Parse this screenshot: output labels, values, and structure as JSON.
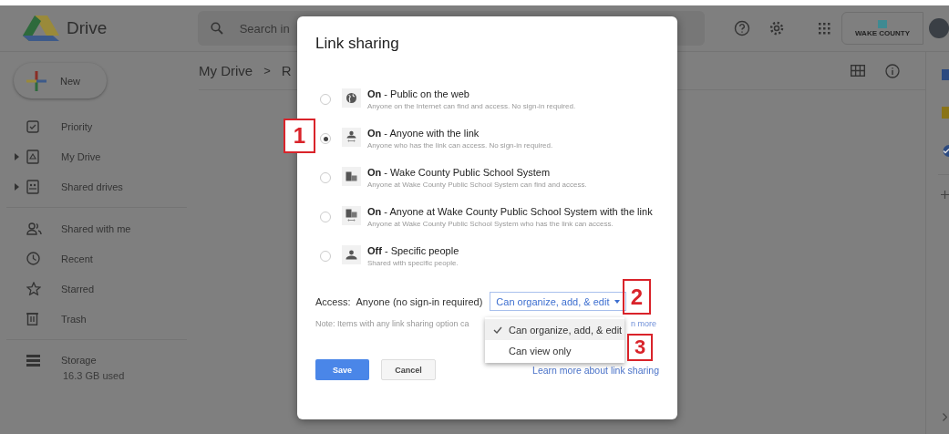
{
  "header": {
    "app_name": "Drive",
    "search": {
      "placeholder": "Search in"
    },
    "org_logo": "WAKE COUNTY"
  },
  "sidebar": {
    "new_button": "New",
    "groups": [
      [
        {
          "label": "Priority",
          "expandable": false
        },
        {
          "label": "My Drive",
          "expandable": true
        },
        {
          "label": "Shared drives",
          "expandable": true
        }
      ],
      [
        {
          "label": "Shared with me",
          "expandable": false
        },
        {
          "label": "Recent",
          "expandable": false
        },
        {
          "label": "Starred",
          "expandable": false
        },
        {
          "label": "Trash",
          "expandable": false
        }
      ],
      [
        {
          "label": "Storage",
          "expandable": false,
          "detail": "16.3 GB used"
        }
      ]
    ]
  },
  "breadcrumb": [
    "My Drive",
    ">",
    "R"
  ],
  "dialog": {
    "title": "Link sharing",
    "options": [
      {
        "title": "**On** - Public on the web",
        "description": "Anyone on the Internet can find and access. No sign-in required.",
        "selected": false
      },
      {
        "title": "**On** - Anyone with the link",
        "description": "Anyone who has the link can access. No sign-in required.",
        "selected": true
      },
      {
        "title": "**On** - Wake County Public School System",
        "description": "Anyone at Wake County Public School System can find and access.",
        "selected": false
      },
      {
        "title": "**On** - Anyone at Wake County Public School System with the link",
        "description": "Anyone at Wake County Public School System who has the link can access.",
        "selected": false
      },
      {
        "title": "**Off** - Specific people",
        "description": "Shared with specific people.",
        "selected": false
      }
    ],
    "access": {
      "label": "Access:",
      "value": "Anyone (no sign-in required)",
      "permission": "Can organize, add, & edit"
    },
    "permission_menu": [
      {
        "label": "Can organize, add, & edit",
        "checked": true
      },
      {
        "label": "Can view only",
        "checked": false
      }
    ],
    "note": "Note: Items with any link sharing option ca",
    "note_link": "n more",
    "save": "Save",
    "cancel": "Cancel",
    "learn_more": "Learn more about link sharing"
  },
  "annotations": [
    "1",
    "2",
    "3"
  ]
}
